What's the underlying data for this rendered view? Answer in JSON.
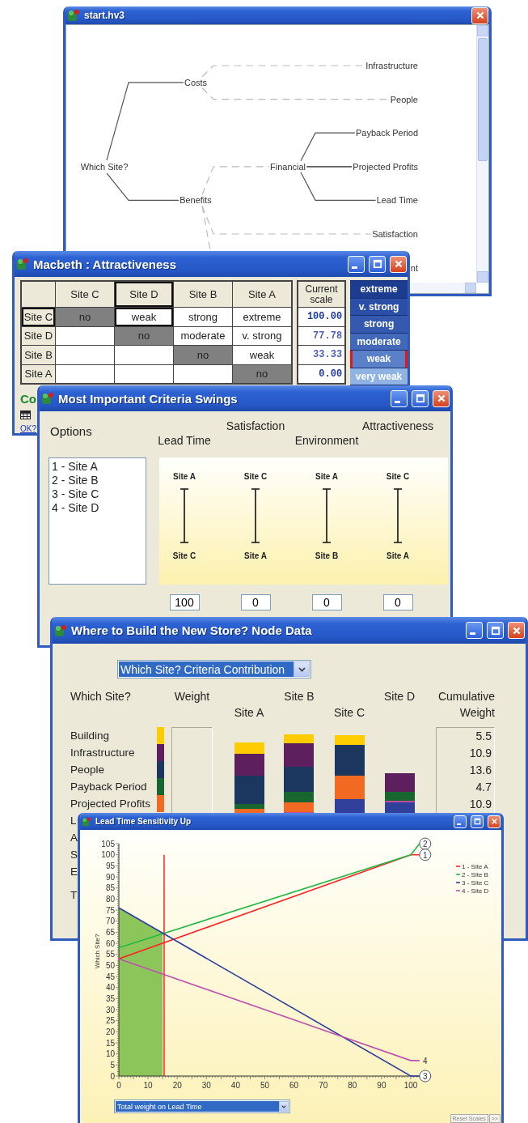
{
  "tree_window": {
    "title": "start.hv3",
    "tree": {
      "label": "Which Site?",
      "children": [
        {
          "label": "Costs",
          "dashed": false,
          "children": [
            {
              "label": "Infrastructure",
              "dashed": true
            },
            {
              "label": "People",
              "dashed": true
            }
          ]
        },
        {
          "label": "Benefits",
          "dashed": false,
          "children": [
            {
              "label": "Financial",
              "dashed": true,
              "children": [
                {
                  "label": "Payback Period",
                  "dashed": false
                },
                {
                  "label": "Projected Profits",
                  "dashed": false
                },
                {
                  "label": "Lead Time",
                  "dashed": false
                }
              ]
            },
            {
              "label": "Satisfaction",
              "dashed": true
            },
            {
              "label": "nt",
              "dashed": true
            }
          ]
        }
      ]
    }
  },
  "macbeth_window": {
    "title": "Macbeth : Attractiveness",
    "columns": [
      {
        "label": "Site C",
        "selected": false
      },
      {
        "label": "Site D",
        "selected": true
      },
      {
        "label": "Site B",
        "selected": false
      },
      {
        "label": "Site A",
        "selected": false
      }
    ],
    "rows": [
      {
        "label": "Site C",
        "selected": true,
        "cells": [
          {
            "kind": "diagonal",
            "text": "no",
            "selected": false
          },
          {
            "kind": "value",
            "text": "weak",
            "selected": true
          },
          {
            "kind": "value",
            "text": "strong",
            "selected": false
          },
          {
            "kind": "value",
            "text": "extreme",
            "selected": false
          }
        ]
      },
      {
        "label": "Site D",
        "selected": false,
        "cells": [
          {
            "kind": "empty",
            "selected": false
          },
          {
            "kind": "diagonal",
            "text": "no",
            "selected": false
          },
          {
            "kind": "value",
            "text": "moderate",
            "selected": false
          },
          {
            "kind": "value",
            "text": "v. strong",
            "selected": false
          }
        ]
      },
      {
        "label": "Site B",
        "selected": false,
        "cells": [
          {
            "kind": "empty",
            "selected": false
          },
          {
            "kind": "empty",
            "selected": false
          },
          {
            "kind": "diagonal",
            "text": "no",
            "selected": false
          },
          {
            "kind": "value",
            "text": "weak",
            "selected": false
          }
        ]
      },
      {
        "label": "Site A",
        "selected": false,
        "cells": [
          {
            "kind": "empty",
            "selected": false
          },
          {
            "kind": "empty",
            "selected": false
          },
          {
            "kind": "empty",
            "selected": false
          },
          {
            "kind": "diagonal",
            "text": "no",
            "selected": false
          }
        ]
      }
    ],
    "scale_heading": "Current scale",
    "scale": [
      {
        "value": "100.00",
        "fixed": true
      },
      {
        "value": "77.78",
        "fixed": false
      },
      {
        "value": "33.33",
        "fixed": false
      },
      {
        "value": "0.00",
        "fixed": true
      }
    ],
    "categories": [
      {
        "label": "extreme",
        "color": "#1c3c8f",
        "selected": false
      },
      {
        "label": "v. strong",
        "color": "#2b4ea6",
        "selected": false
      },
      {
        "label": "strong",
        "color": "#3659b0",
        "selected": false
      },
      {
        "label": "moderate",
        "color": "#4268ba",
        "selected": false
      },
      {
        "label": "weak",
        "color": "#5a80c8",
        "selected": true
      },
      {
        "label": "very weak",
        "color": "#8fb3e3",
        "selected": false
      }
    ],
    "status_cut": "Co",
    "ok_link": "OK?"
  },
  "swings_window": {
    "title": "Most Important Criteria Swings",
    "options_heading": "Options",
    "options": [
      "1 - Site A",
      "2 - Site B",
      "3 - Site C",
      "4 - Site D"
    ],
    "criteria": [
      {
        "label": "Lead Time",
        "top": "Site A",
        "bottom": "Site C",
        "value": "100"
      },
      {
        "label": "Satisfaction",
        "top": "Site C",
        "bottom": "Site A",
        "value": "0"
      },
      {
        "label": "Environment",
        "top": "Site A",
        "bottom": "Site B",
        "value": "0"
      },
      {
        "label": "Attractiveness",
        "top": "Site C",
        "bottom": "Site A",
        "value": "0"
      }
    ]
  },
  "node_window": {
    "title": "Where to Build the New Store? Node Data",
    "dropdown": "Which Site? Criteria Contribution",
    "headings": {
      "criteria": "Which Site?",
      "weight": "Weight",
      "sites": [
        "Site A",
        "Site B",
        "Site C",
        "Site D"
      ],
      "cumulative": "Cumulative Weight"
    },
    "criteria": [
      {
        "label": "Building",
        "color": "#ffcc00",
        "cumulative": "5.5"
      },
      {
        "label": "Infrastructure",
        "color": "#5e1f5e",
        "cumulative": "10.9"
      },
      {
        "label": "People",
        "color": "#1b365f",
        "cumulative": "13.6"
      },
      {
        "label": "Payback Period",
        "color": "#17652f",
        "cumulative": "4.7"
      },
      {
        "label": "Projected Profits",
        "color": "#f26a21",
        "cumulative": "10.9"
      }
    ],
    "cut_labels": [
      "L",
      "A",
      "S",
      "E"
    ],
    "cut_total": "T"
  },
  "lead_window": {
    "title": "Lead Time Sensitivity Up",
    "chart_data": {
      "type": "line",
      "ylabel": "Which Site?",
      "x": [
        0,
        100,
        103
      ],
      "series": [
        {
          "name": "1 - Site A",
          "color": "#ff2020",
          "values": [
            53,
            100,
            100
          ]
        },
        {
          "name": "2 - Site B",
          "color": "#22b844",
          "values": [
            58,
            100,
            105
          ]
        },
        {
          "name": "3 - Site C",
          "color": "#2b3f9e",
          "values": [
            76,
            0,
            0
          ]
        },
        {
          "name": "4 - Site D",
          "color": "#c050b0",
          "values": [
            53,
            7,
            7
          ]
        }
      ],
      "legend": "upper right",
      "xlim": [
        0,
        105
      ],
      "ylim": [
        0,
        105
      ],
      "xticks": [
        0,
        10,
        20,
        30,
        40,
        50,
        60,
        70,
        80,
        90,
        100
      ],
      "yticks": [
        0,
        5,
        10,
        15,
        20,
        25,
        30,
        35,
        40,
        45,
        50,
        55,
        60,
        65,
        70,
        75,
        80,
        85,
        90,
        95,
        100,
        105
      ],
      "ref_lines": [
        {
          "axis": "x",
          "value": 15.5,
          "color": "#ff2020"
        }
      ],
      "bands": [
        {
          "axis": "x",
          "from": 0,
          "to": 15,
          "color": "#8cc65a"
        }
      ]
    },
    "end_labels": [
      {
        "text": "2",
        "kind": "circled"
      },
      {
        "text": "1",
        "kind": "circled"
      },
      {
        "text": "4",
        "kind": "plain"
      },
      {
        "text": "3",
        "kind": "circled"
      }
    ],
    "dropdown": "Total weight on Lead Time",
    "buttons": [
      "Reset Scales",
      ">>"
    ]
  }
}
